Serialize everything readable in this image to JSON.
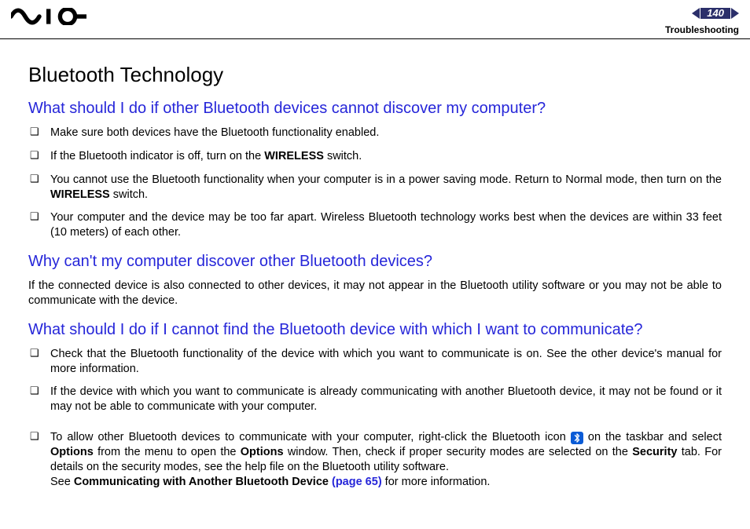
{
  "header": {
    "page_number": "140",
    "section": "Troubleshooting"
  },
  "title": "Bluetooth Technology",
  "q1": {
    "heading": "What should I do if other Bluetooth devices cannot discover my computer?",
    "b1": "Make sure both devices have the Bluetooth functionality enabled.",
    "b2a": "If the Bluetooth indicator is off, turn on the ",
    "b2b": "WIRELESS",
    "b2c": " switch.",
    "b3a": "You cannot use the Bluetooth functionality when your computer is in a power saving mode. Return to Normal mode, then turn on the ",
    "b3b": "WIRELESS",
    "b3c": " switch.",
    "b4": "Your computer and the device may be too far apart. Wireless Bluetooth technology works best when the devices are within 33 feet (10 meters) of each other."
  },
  "q2": {
    "heading": "Why can't my computer discover other Bluetooth devices?",
    "p1": "If the connected device is also connected to other devices, it may not appear in the Bluetooth utility software or you may not be able to communicate with the device."
  },
  "q3": {
    "heading": "What should I do if I cannot find the Bluetooth device with which I want to communicate?",
    "b1": "Check that the Bluetooth functionality of the device with which you want to communicate is on. See the other device's manual for more information.",
    "b2": "If the device with which you want to communicate is already communicating with another Bluetooth device, it may not be found or it may not be able to communicate with your computer.",
    "b3a": "To allow other Bluetooth devices to communicate with your computer, right-click the Bluetooth icon ",
    "b3b": " on the taskbar and select ",
    "b3c": "Options",
    "b3d": " from the menu to open the ",
    "b3e": "Options",
    "b3f": " window. Then, check if proper security modes are selected on the ",
    "b3g": "Security",
    "b3h": " tab. For details on the security modes, see the help file on the Bluetooth utility software.",
    "b3i": "See ",
    "b3j": "Communicating with Another Bluetooth Device ",
    "b3k": "(page 65)",
    "b3l": " for more information."
  }
}
